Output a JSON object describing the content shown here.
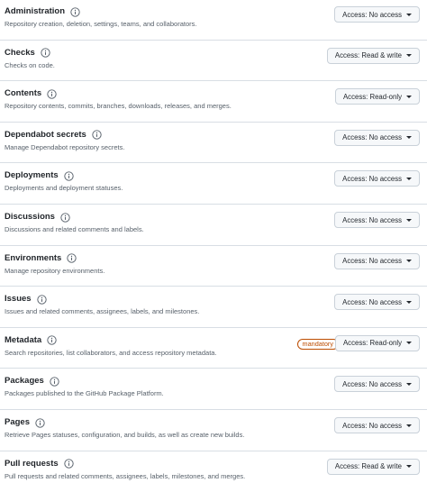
{
  "permissions": [
    {
      "title": "Administration",
      "description": "Repository creation, deletion, settings, teams, and collaborators.",
      "access": "Access: No access"
    },
    {
      "title": "Checks",
      "description": "Checks on code.",
      "access": "Access: Read & write"
    },
    {
      "title": "Contents",
      "description": "Repository contents, commits, branches, downloads, releases, and merges.",
      "access": "Access: Read-only"
    },
    {
      "title": "Dependabot secrets",
      "description": "Manage Dependabot repository secrets.",
      "access": "Access: No access"
    },
    {
      "title": "Deployments",
      "description": "Deployments and deployment statuses.",
      "access": "Access: No access"
    },
    {
      "title": "Discussions",
      "description": "Discussions and related comments and labels.",
      "access": "Access: No access"
    },
    {
      "title": "Environments",
      "description": "Manage repository environments.",
      "access": "Access: No access"
    },
    {
      "title": "Issues",
      "description": "Issues and related comments, assignees, labels, and milestones.",
      "access": "Access: No access"
    },
    {
      "title": "Metadata",
      "description": "Search repositories, list collaborators, and access repository metadata.",
      "access": "Access: Read-only",
      "badge": "mandatory"
    },
    {
      "title": "Packages",
      "description": "Packages published to the GitHub Package Platform.",
      "access": "Access: No access"
    },
    {
      "title": "Pages",
      "description": "Retrieve Pages statuses, configuration, and builds, as well as create new builds.",
      "access": "Access: No access"
    },
    {
      "title": "Pull requests",
      "description": "Pull requests and related comments, assignees, labels, milestones, and merges.",
      "access": "Access: Read & write"
    }
  ],
  "icons": {
    "info": "info-icon",
    "dropdown": "caret-down-icon"
  },
  "colors": {
    "badge": "#bc4c00",
    "border": "#d8dee4",
    "muted_text": "#57606a"
  }
}
